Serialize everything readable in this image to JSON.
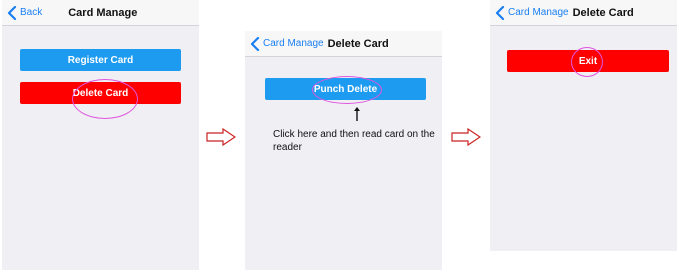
{
  "colors": {
    "accent_blue": "#1d9bf0",
    "link_blue": "#1a7ff2",
    "danger_red": "#ff0000",
    "highlight_pink": "#e055e0",
    "arrow_red": "#cc2222",
    "screen_bg": "#efeff4"
  },
  "screen1": {
    "back_label": "Back",
    "title": "Card Manage",
    "register_button": "Register Card",
    "delete_button": "Delete Card"
  },
  "screen2": {
    "back_label": "Card Manage",
    "title": "Delete Card",
    "punch_delete_button": "Punch Delete",
    "instruction": "Click here and then read card on the reader"
  },
  "screen3": {
    "back_label": "Card Manage",
    "title": "Delete Card",
    "exit_button": "Exit"
  },
  "icons": {
    "back": "chevron-left-icon",
    "flow_arrow": "arrow-right-icon",
    "pointer": "arrow-up-icon"
  }
}
